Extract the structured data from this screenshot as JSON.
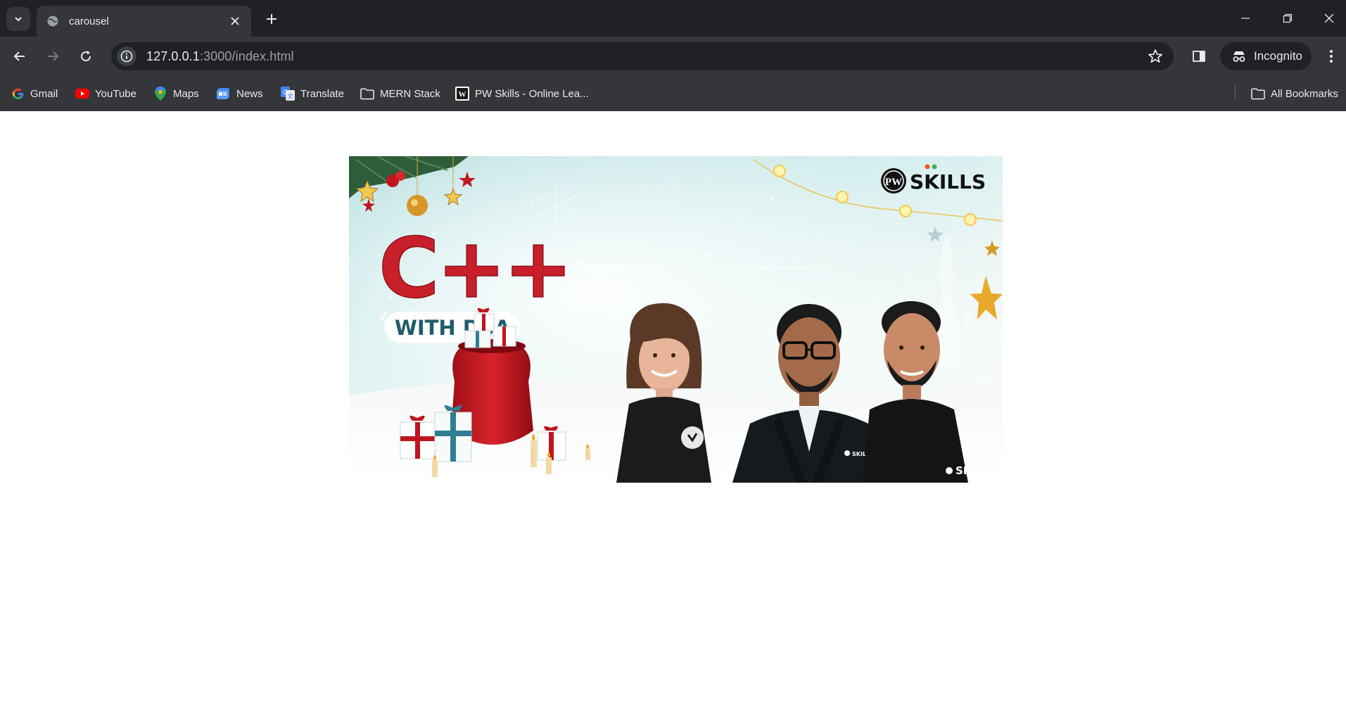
{
  "browser": {
    "tab": {
      "title": "carousel"
    },
    "address": {
      "host": "127.0.0.1",
      "rest": ":3000/index.html"
    },
    "profile_label": "Incognito",
    "bookmarks": [
      {
        "label": "Gmail",
        "icon": "google-icon"
      },
      {
        "label": "YouTube",
        "icon": "youtube-icon"
      },
      {
        "label": "Maps",
        "icon": "maps-pin-icon"
      },
      {
        "label": "News",
        "icon": "news-icon"
      },
      {
        "label": "Translate",
        "icon": "translate-icon"
      },
      {
        "label": "MERN Stack",
        "icon": "folder-icon"
      },
      {
        "label": "PW Skills - Online Lea...",
        "icon": "pw-logo-icon"
      }
    ],
    "all_bookmarks_label": "All Bookmarks"
  },
  "carousel": {
    "slide": {
      "headline": "C++",
      "pill_text": "WITH DSA",
      "brand_mark": "PW",
      "brand_text": "SKILLS",
      "shirt_logo": "SKILLS"
    },
    "colors": {
      "headline": "#c8202a",
      "pill_text": "#1f5d6b",
      "brand": "#111111"
    }
  }
}
